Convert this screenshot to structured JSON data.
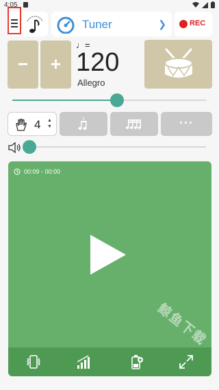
{
  "status_bar": {
    "time": "4:05"
  },
  "toolbar": {
    "tuner_label": "Tuner",
    "rec_label": "REC"
  },
  "tempo": {
    "note_equals": "♩=",
    "bpm": "120",
    "name": "Allegro",
    "slider_fraction": 0.54
  },
  "controls": {
    "minus_label": "−",
    "plus_label": "+",
    "beats_per_measure": "4",
    "more_label": "···"
  },
  "volume": {
    "fraction": 0.03
  },
  "player": {
    "time_display": "00:09 - 00:00"
  },
  "watermark": "鲸鱼下载",
  "icons": {
    "menu": "hamburger-icon",
    "note_gauge": "music-note-gauge-icon",
    "tuner": "speedometer-icon",
    "drum": "drum-icon",
    "beats": "hand-clap-icon",
    "subdivision": "triplet-note-icon",
    "accent": "sixteenth-notes-icon",
    "volume": "speaker-icon",
    "clock": "clock-icon",
    "vibrate": "vibrate-phone-icon",
    "tempo_ramp": "signal-bars-icon",
    "battery": "battery-plus-icon",
    "fullscreen": "expand-icon"
  },
  "colors": {
    "accent_green": "#4aa994",
    "player_green": "#67b06b",
    "player_bar": "#4e9a53",
    "tan": "#cfc7a8",
    "rec_red": "#e0201c",
    "tuner_blue": "#3e90d8"
  }
}
